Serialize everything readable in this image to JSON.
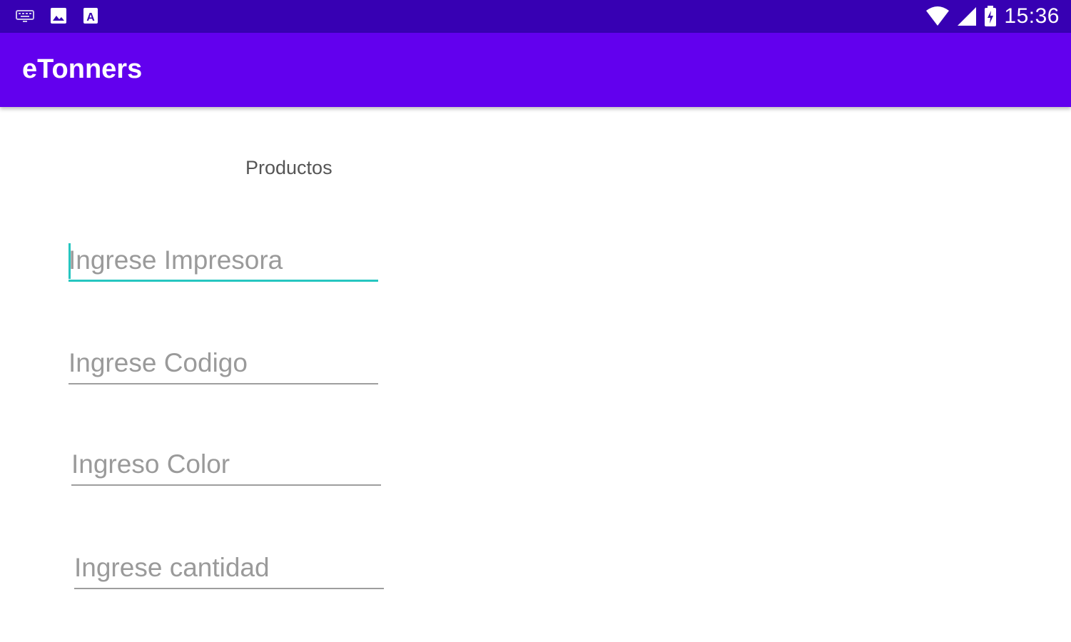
{
  "status_bar": {
    "time": "15:36",
    "left_icons": [
      "keyboard-icon",
      "image-icon",
      "a-box-icon"
    ],
    "right_icons": [
      "wifi-icon",
      "cell-signal-icon",
      "battery-icon"
    ],
    "color": "#3700b3"
  },
  "app_bar": {
    "title": "eTonners",
    "color": "#6200ee"
  },
  "content": {
    "title": "Productos",
    "fields": [
      {
        "placeholder": "Ingrese Impresora",
        "value": "",
        "focused": true
      },
      {
        "placeholder": "Ingrese Codigo",
        "value": ""
      },
      {
        "placeholder": "Ingreso Color",
        "value": ""
      },
      {
        "placeholder": "Ingrese cantidad",
        "value": ""
      }
    ],
    "accent_color": "#26c6c0"
  }
}
